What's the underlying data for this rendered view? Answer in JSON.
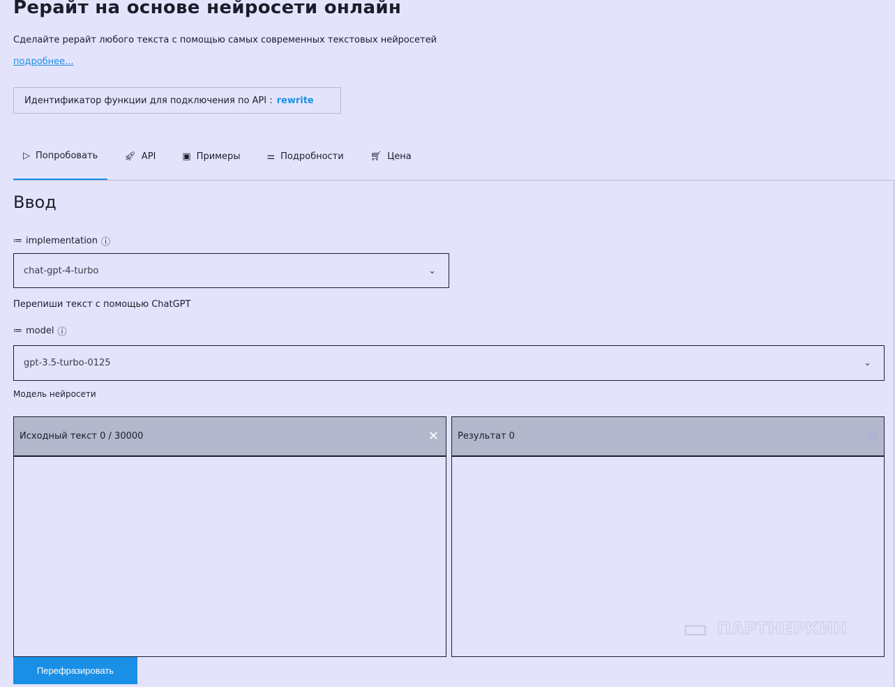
{
  "page": {
    "title": "Рерайт на основе нейросети онлайн",
    "subtitle": "Сделайте рерайт любого текста с помощью самых современных текстовых нейросетей",
    "more_link": "подробнее..."
  },
  "api": {
    "label": "Идентификатор функции для подключения по API :",
    "id": "rewrite"
  },
  "tabs": [
    {
      "label": "Попробовать",
      "icon": "play-icon"
    },
    {
      "label": "API",
      "icon": "rocket-icon"
    },
    {
      "label": "Примеры",
      "icon": "book-icon"
    },
    {
      "label": "Подробности",
      "icon": "settings-icon"
    },
    {
      "label": "Цена",
      "icon": "cart-icon"
    }
  ],
  "input": {
    "heading": "Ввод",
    "implementation": {
      "label": "implementation",
      "value": "chat-gpt-4-turbo",
      "help": "Перепиши текст с помощью ChatGPT"
    },
    "model": {
      "label": "model",
      "value": "gpt-3.5-turbo-0125",
      "help": "Модель нейросети"
    }
  },
  "source": {
    "label": "Исходный текст 0 / 30000"
  },
  "result": {
    "label": "Результат 0"
  },
  "button": "Перефразировать",
  "watermark": "ПАРТНЕРКИН"
}
